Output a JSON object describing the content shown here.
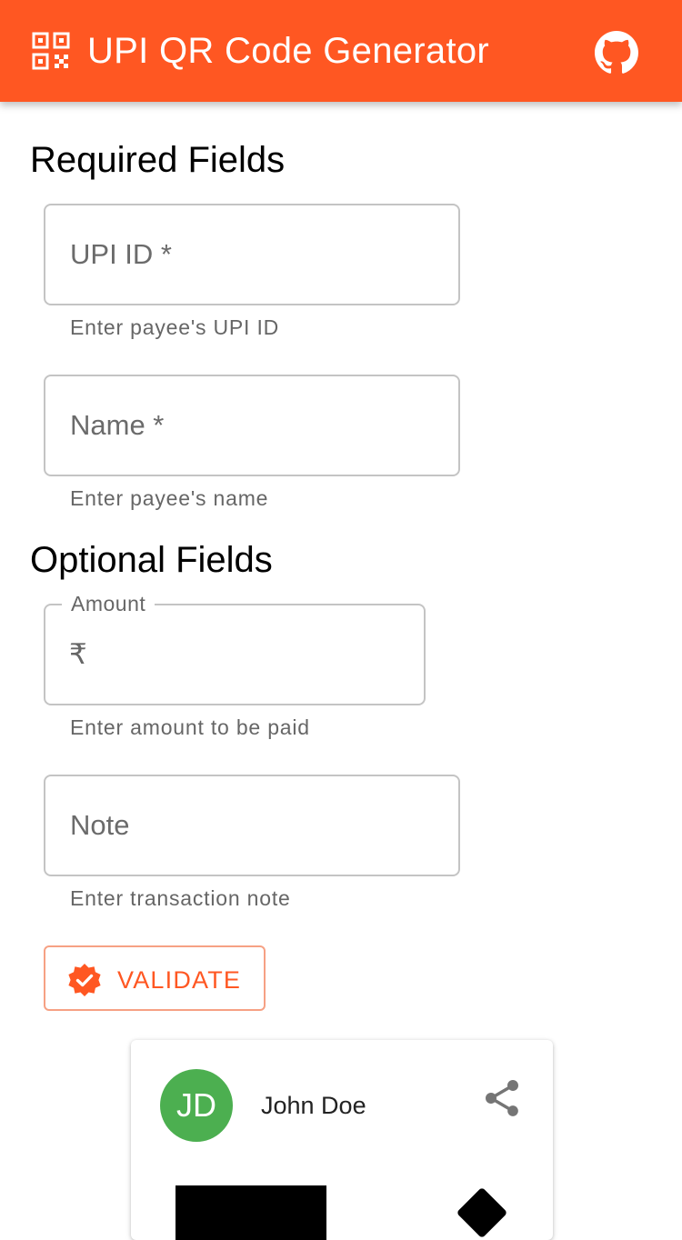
{
  "appbar": {
    "title": "UPI QR Code Generator",
    "icon": "qr-code-scanner-icon",
    "action_icon": "github-icon",
    "color": "#ff5722"
  },
  "required": {
    "heading": "Required Fields",
    "upi_id": {
      "placeholder": "UPI ID *",
      "value": "",
      "helper": "Enter payee's UPI ID"
    },
    "name": {
      "placeholder": "Name *",
      "value": "",
      "helper": "Enter payee's name"
    }
  },
  "optional": {
    "heading": "Optional Fields",
    "amount": {
      "label": "Amount",
      "prefix": "₹",
      "value": "",
      "helper": "Enter amount to be paid"
    },
    "note": {
      "placeholder": "Note",
      "value": "",
      "helper": "Enter transaction note"
    }
  },
  "validate": {
    "label": "VALIDATE",
    "icon": "verified-badge-icon"
  },
  "card": {
    "avatar_initials": "JD",
    "avatar_color": "#4caf50",
    "name": "John Doe",
    "share_icon": "share-icon"
  }
}
